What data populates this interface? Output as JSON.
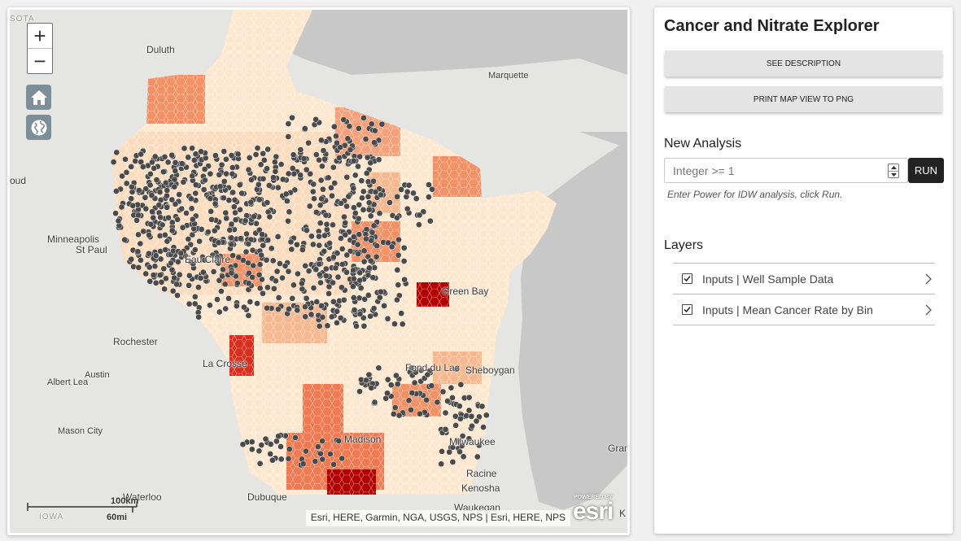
{
  "map": {
    "zoom_in_label": "+",
    "zoom_out_label": "−",
    "home_icon": "home-icon",
    "basemap_icon": "globe-icon",
    "places": [
      {
        "name": "Duluth",
        "cls": "place"
      },
      {
        "name": "Marquette",
        "cls": "place small"
      },
      {
        "name": "oud",
        "cls": "place"
      },
      {
        "name": "Minneapolis",
        "cls": "place"
      },
      {
        "name": "St Paul",
        "cls": "place"
      },
      {
        "name": "Eau Claire",
        "cls": "place"
      },
      {
        "name": "Green Bay",
        "cls": "place"
      },
      {
        "name": "Rochester",
        "cls": "place"
      },
      {
        "name": "La Crosse",
        "cls": "place"
      },
      {
        "name": "Austin",
        "cls": "place small"
      },
      {
        "name": "Albert Lea",
        "cls": "place small"
      },
      {
        "name": "Fond du Lac",
        "cls": "place"
      },
      {
        "name": "Sheboygan",
        "cls": "place"
      },
      {
        "name": "Mason City",
        "cls": "place small"
      },
      {
        "name": "Madison",
        "cls": "place"
      },
      {
        "name": "Milwaukee",
        "cls": "place"
      },
      {
        "name": "Gran",
        "cls": "place"
      },
      {
        "name": "Racine",
        "cls": "place"
      },
      {
        "name": "Kenosha",
        "cls": "place"
      },
      {
        "name": "Waterloo",
        "cls": "place"
      },
      {
        "name": "Dubuque",
        "cls": "place"
      },
      {
        "name": "Waukegan",
        "cls": "place"
      },
      {
        "name": "K",
        "cls": "place"
      },
      {
        "name": "SOTA",
        "cls": "place state"
      },
      {
        "name": "IOWA",
        "cls": "place state"
      }
    ],
    "scale_km": "100km",
    "scale_mi": "60mi",
    "attribution": "Esri, HERE, Garmin, NGA, USGS, NPS | Esri, HERE, NPS",
    "powered_by": "POWERED BY",
    "esri_wordmark": "esri"
  },
  "panel": {
    "title": "Cancer and Nitrate Explorer",
    "see_description_label": "SEE DESCRIPTION",
    "print_map_label": "PRINT MAP VIEW TO PNG",
    "new_analysis_heading": "New Analysis",
    "power_input_placeholder": "Integer >= 1",
    "power_input_value": "",
    "run_label": "RUN",
    "hint": "Enter Power for IDW analysis, click Run.",
    "layers_heading": "Layers",
    "layers": [
      {
        "label": "Inputs | Well Sample Data",
        "checked": true
      },
      {
        "label": "Inputs | Mean Cancer Rate by Bin",
        "checked": true
      }
    ]
  },
  "colors": {
    "hex_light": "#fde7cf",
    "hex_mid": "#f6b88f",
    "hex_orange": "#ef7a52",
    "hex_red": "#d7301f",
    "hex_darkred": "#9b0000",
    "well_point": "#4a4a4a",
    "water": "#c8c8c8",
    "land": "#e5e5e3"
  }
}
